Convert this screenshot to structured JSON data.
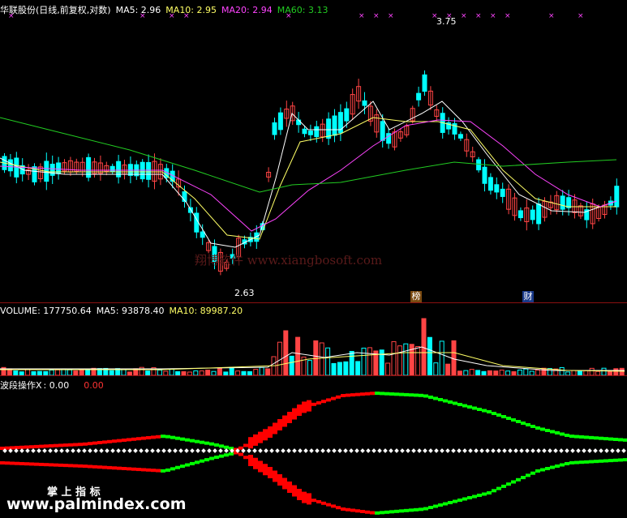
{
  "price_header": {
    "title": "华联股份(日线,前复权,对数)",
    "ma5_label": "MA5: 2.96",
    "ma10_label": "MA10: 2.95",
    "ma20_label": "MA20: 2.94",
    "ma60_label": "MA60: 3.13"
  },
  "price_annotations": {
    "high": "3.75",
    "low": "2.63"
  },
  "badges": {
    "bang": "榜",
    "cai": "财"
  },
  "watermark": "翔博软件  www.xiangbosoft.com",
  "volume_header": {
    "vol_label": "VOLUME: 177750.64",
    "ma5_label": "MA5: 93878.40",
    "ma10_label": "MA10: 89987.20"
  },
  "wave_header": {
    "title": "波段操作X",
    "value1": ": 0.00",
    "value2": "0.00"
  },
  "bottom": {
    "brand": "掌 上 指 标",
    "url": "www.palmindex.com"
  },
  "colors": {
    "up": "#ff4444",
    "down": "#00ffff",
    "ma5": "#ffffff",
    "ma10": "#ffff66",
    "ma20": "#ff44ff",
    "ma60": "#22cc22",
    "green": "#00ff00",
    "red": "#ff0000",
    "separator": "#8a1010"
  }
}
